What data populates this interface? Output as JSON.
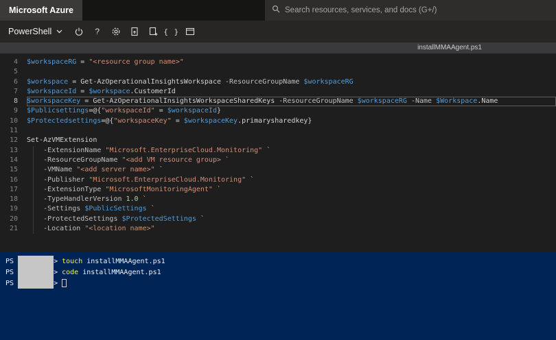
{
  "topbar": {
    "brand": "Microsoft Azure",
    "search_placeholder": "Search resources, services, and docs (G+/)"
  },
  "toolbar": {
    "shell_selector": "PowerShell",
    "icons": [
      "power-icon",
      "help-icon",
      "settings-icon",
      "upload-download-icon",
      "new-session-icon",
      "open-editor-icon",
      "web-preview-icon"
    ],
    "open_editor_glyph": "{ }",
    "help_glyph": "?"
  },
  "editor": {
    "filename": "installMMAAgent.ps1",
    "current_line": 8,
    "lines": [
      {
        "num": 4,
        "tokens": [
          {
            "t": "var",
            "x": "$workspaceRG"
          },
          {
            "t": "plain",
            "x": " = "
          },
          {
            "t": "str",
            "x": "\"<resource group name>\""
          }
        ]
      },
      {
        "num": 5,
        "tokens": []
      },
      {
        "num": 6,
        "tokens": [
          {
            "t": "var",
            "x": "$workspace"
          },
          {
            "t": "plain",
            "x": " = "
          },
          {
            "t": "cmd",
            "x": "Get-AzOperationalInsightsWorkspace"
          },
          {
            "t": "plain",
            "x": " "
          },
          {
            "t": "param",
            "x": "-ResourceGroupName"
          },
          {
            "t": "plain",
            "x": " "
          },
          {
            "t": "var",
            "x": "$workspaceRG"
          }
        ]
      },
      {
        "num": 7,
        "tokens": [
          {
            "t": "var",
            "x": "$workspaceId"
          },
          {
            "t": "plain",
            "x": " = "
          },
          {
            "t": "var",
            "x": "$workspace"
          },
          {
            "t": "plain",
            "x": ".CustomerId"
          }
        ]
      },
      {
        "num": 8,
        "tokens": [
          {
            "t": "var",
            "x": "$workspaceKey"
          },
          {
            "t": "plain",
            "x": " = "
          },
          {
            "t": "cmd",
            "x": "Get-AzOperationalInsightsWorkspaceSharedKeys"
          },
          {
            "t": "plain",
            "x": " "
          },
          {
            "t": "param",
            "x": "-ResourceGroupName"
          },
          {
            "t": "plain",
            "x": " "
          },
          {
            "t": "var",
            "x": "$workspaceRG"
          },
          {
            "t": "plain",
            "x": " "
          },
          {
            "t": "param",
            "x": "-Name"
          },
          {
            "t": "plain",
            "x": " "
          },
          {
            "t": "var",
            "x": "$Workspace"
          },
          {
            "t": "plain",
            "x": ".Name"
          }
        ]
      },
      {
        "num": 9,
        "tokens": [
          {
            "t": "var",
            "x": "$Publicsettings"
          },
          {
            "t": "plain",
            "x": "=@{"
          },
          {
            "t": "str",
            "x": "\"workspaceId\""
          },
          {
            "t": "plain",
            "x": " = "
          },
          {
            "t": "var",
            "x": "$workspaceId"
          },
          {
            "t": "plain",
            "x": "}"
          }
        ]
      },
      {
        "num": 10,
        "tokens": [
          {
            "t": "var",
            "x": "$Protectedsettings"
          },
          {
            "t": "plain",
            "x": "=@{"
          },
          {
            "t": "str",
            "x": "\"workspaceKey\""
          },
          {
            "t": "plain",
            "x": " = "
          },
          {
            "t": "var",
            "x": "$workspaceKey"
          },
          {
            "t": "plain",
            "x": ".primarysharedkey}"
          }
        ]
      },
      {
        "num": 11,
        "tokens": []
      },
      {
        "num": 12,
        "tokens": [
          {
            "t": "cmd",
            "x": "Set-AzVMExtension"
          }
        ]
      },
      {
        "num": 13,
        "tokens": [
          {
            "t": "plain",
            "x": "    "
          },
          {
            "t": "param",
            "x": "-ExtensionName"
          },
          {
            "t": "plain",
            "x": " "
          },
          {
            "t": "str",
            "x": "\"Microsoft.EnterpriseCloud.Monitoring\""
          },
          {
            "t": "plain",
            "x": " "
          },
          {
            "t": "esc",
            "x": "`"
          }
        ]
      },
      {
        "num": 14,
        "tokens": [
          {
            "t": "plain",
            "x": "    "
          },
          {
            "t": "param",
            "x": "-ResourceGroupName"
          },
          {
            "t": "plain",
            "x": " "
          },
          {
            "t": "str",
            "x": "\"<add VM resource group>"
          },
          {
            "t": "plain",
            "x": " "
          },
          {
            "t": "esc",
            "x": "`"
          }
        ]
      },
      {
        "num": 15,
        "tokens": [
          {
            "t": "plain",
            "x": "    "
          },
          {
            "t": "param",
            "x": "-VMName"
          },
          {
            "t": "plain",
            "x": " "
          },
          {
            "t": "str",
            "x": "\"<add server name>\""
          },
          {
            "t": "plain",
            "x": " "
          },
          {
            "t": "esc",
            "x": "`"
          }
        ]
      },
      {
        "num": 16,
        "tokens": [
          {
            "t": "plain",
            "x": "    "
          },
          {
            "t": "param",
            "x": "-Publisher"
          },
          {
            "t": "plain",
            "x": " "
          },
          {
            "t": "str",
            "x": "\"Microsoft.EnterpriseCloud.Monitoring\""
          },
          {
            "t": "plain",
            "x": " "
          },
          {
            "t": "esc",
            "x": "`"
          }
        ]
      },
      {
        "num": 17,
        "tokens": [
          {
            "t": "plain",
            "x": "    "
          },
          {
            "t": "param",
            "x": "-ExtensionType"
          },
          {
            "t": "plain",
            "x": " "
          },
          {
            "t": "str",
            "x": "\"MicrosoftMonitoringAgent\""
          },
          {
            "t": "plain",
            "x": " "
          },
          {
            "t": "esc",
            "x": "`"
          }
        ]
      },
      {
        "num": 18,
        "tokens": [
          {
            "t": "plain",
            "x": "    "
          },
          {
            "t": "param",
            "x": "-TypeHandlerVersion"
          },
          {
            "t": "plain",
            "x": " "
          },
          {
            "t": "num",
            "x": "1.0"
          },
          {
            "t": "plain",
            "x": " "
          },
          {
            "t": "esc",
            "x": "`"
          }
        ]
      },
      {
        "num": 19,
        "tokens": [
          {
            "t": "plain",
            "x": "    "
          },
          {
            "t": "param",
            "x": "-Settings"
          },
          {
            "t": "plain",
            "x": " "
          },
          {
            "t": "var",
            "x": "$PublicSettings"
          },
          {
            "t": "plain",
            "x": " "
          },
          {
            "t": "esc",
            "x": "`"
          }
        ]
      },
      {
        "num": 20,
        "tokens": [
          {
            "t": "plain",
            "x": "    "
          },
          {
            "t": "param",
            "x": "-ProtectedSettings"
          },
          {
            "t": "plain",
            "x": " "
          },
          {
            "t": "var",
            "x": "$ProtectedSettings"
          },
          {
            "t": "plain",
            "x": " "
          },
          {
            "t": "esc",
            "x": "`"
          }
        ]
      },
      {
        "num": 21,
        "tokens": [
          {
            "t": "plain",
            "x": "    "
          },
          {
            "t": "param",
            "x": "-Location"
          },
          {
            "t": "plain",
            "x": " "
          },
          {
            "t": "str",
            "x": "\"<location name>\""
          }
        ]
      }
    ]
  },
  "terminal": {
    "prompt": "PS",
    "prompt_char": ">",
    "lines": [
      {
        "command": "touch",
        "argument": "installMMAAgent.ps1",
        "cursor": false
      },
      {
        "command": "code",
        "argument": "installMMAAgent.ps1",
        "cursor": false
      },
      {
        "command": "",
        "argument": "",
        "cursor": true
      }
    ]
  },
  "colors": {
    "terminal_bg": "#012456",
    "editor_bg": "#1e1e1e",
    "variable": "#569cd6",
    "string": "#ce9178",
    "terminal_command": "#f5f543",
    "redaction": "#c6c6c6"
  }
}
